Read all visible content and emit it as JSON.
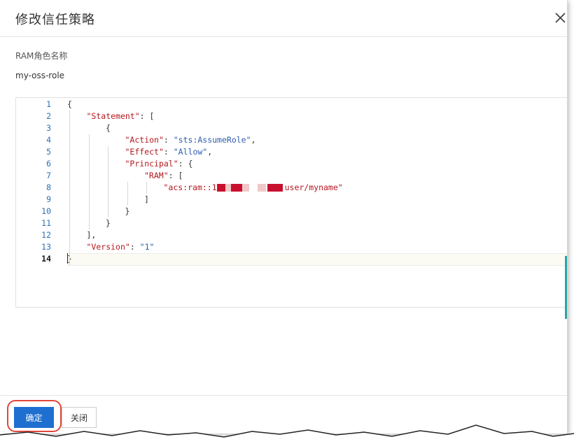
{
  "dialog": {
    "title": "修改信任策略"
  },
  "role": {
    "label": "RAM角色名称",
    "value": "my-oss-role"
  },
  "editor": {
    "line_numbers": [
      "1",
      "2",
      "3",
      "4",
      "5",
      "6",
      "7",
      "8",
      "9",
      "10",
      "11",
      "12",
      "13",
      "14"
    ],
    "active_line": "14",
    "lines": [
      {
        "tokens": [
          {
            "t": "p",
            "v": "{"
          }
        ]
      },
      {
        "tokens": [
          {
            "t": "k",
            "v": "\"Statement\""
          },
          {
            "t": "p",
            "v": ": ["
          }
        ]
      },
      {
        "tokens": [
          {
            "t": "p",
            "v": "{"
          }
        ]
      },
      {
        "tokens": [
          {
            "t": "k",
            "v": "\"Action\""
          },
          {
            "t": "p",
            "v": ": "
          },
          {
            "t": "s",
            "v": "\"sts:AssumeRole\""
          },
          {
            "t": "p",
            "v": ","
          }
        ]
      },
      {
        "tokens": [
          {
            "t": "k",
            "v": "\"Effect\""
          },
          {
            "t": "p",
            "v": ": "
          },
          {
            "t": "s",
            "v": "\"Allow\""
          },
          {
            "t": "p",
            "v": ","
          }
        ]
      },
      {
        "tokens": [
          {
            "t": "k",
            "v": "\"Principal\""
          },
          {
            "t": "p",
            "v": ": {"
          }
        ]
      },
      {
        "tokens": [
          {
            "t": "k",
            "v": "\"RAM\""
          },
          {
            "t": "p",
            "v": ": ["
          }
        ]
      },
      {
        "tokens": [
          {
            "t": "k",
            "v": "\"acs:ram::1"
          },
          {
            "t": "k",
            "v": "             "
          },
          {
            "t": "k",
            "v": ":user/myname\""
          }
        ]
      },
      {
        "tokens": [
          {
            "t": "p",
            "v": "]"
          }
        ]
      },
      {
        "tokens": [
          {
            "t": "p",
            "v": "}"
          }
        ]
      },
      {
        "tokens": [
          {
            "t": "p",
            "v": "}"
          }
        ]
      },
      {
        "tokens": [
          {
            "t": "p",
            "v": "],"
          }
        ]
      },
      {
        "tokens": [
          {
            "t": "k",
            "v": "\"Version\""
          },
          {
            "t": "p",
            "v": ": "
          },
          {
            "t": "s",
            "v": "\"1\""
          }
        ]
      },
      {
        "tokens": [
          {
            "t": "p",
            "v": "}"
          }
        ]
      }
    ]
  },
  "footer": {
    "confirm_label": "确定",
    "close_label": "关闭"
  },
  "colors": {
    "primary": "#1f6fd0",
    "key": "#b5171e",
    "string": "#2f5cae",
    "line_number": "#2b71b8",
    "highlight_ring": "#e0473c"
  },
  "icons": {
    "close": "close-icon"
  }
}
